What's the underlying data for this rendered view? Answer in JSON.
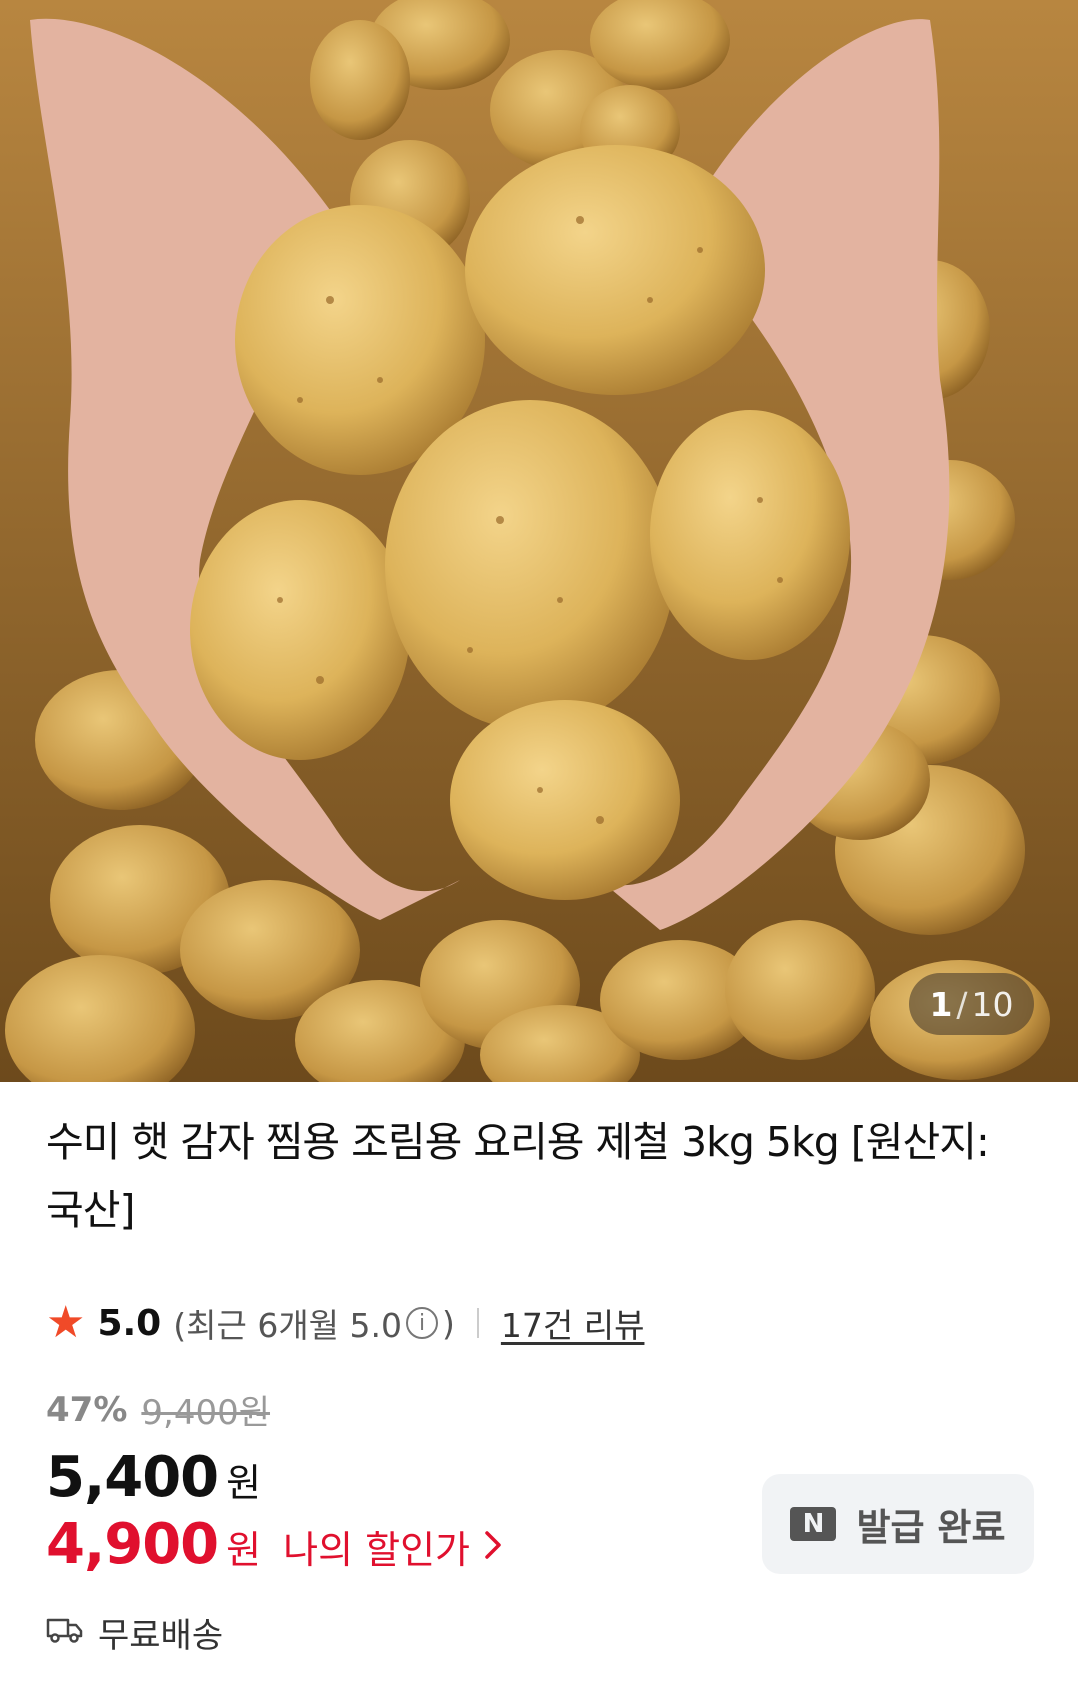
{
  "pager": {
    "current": "1",
    "separator": "/",
    "total": "10"
  },
  "product": {
    "title": "수미 햇 감자 찜용 조림용 요리용 제철 3kg 5kg [원산지: 국산]"
  },
  "rating": {
    "score": "5.0",
    "recent_prefix": "(최근 6개월 5.0",
    "recent_suffix": ")",
    "reviews_link": "17건 리뷰",
    "star_color": "#f04a28"
  },
  "price": {
    "discount_rate": "47%",
    "original_price": "9,400원",
    "sale_price": "5,400",
    "currency": "원",
    "my_price": "4,900",
    "my_price_currency": "원",
    "my_price_label": "나의 할인가",
    "accent_color": "#e0102e"
  },
  "coupon": {
    "icon_letter": "N",
    "label": "발급 완료"
  },
  "shipping": {
    "label": "무료배송"
  }
}
